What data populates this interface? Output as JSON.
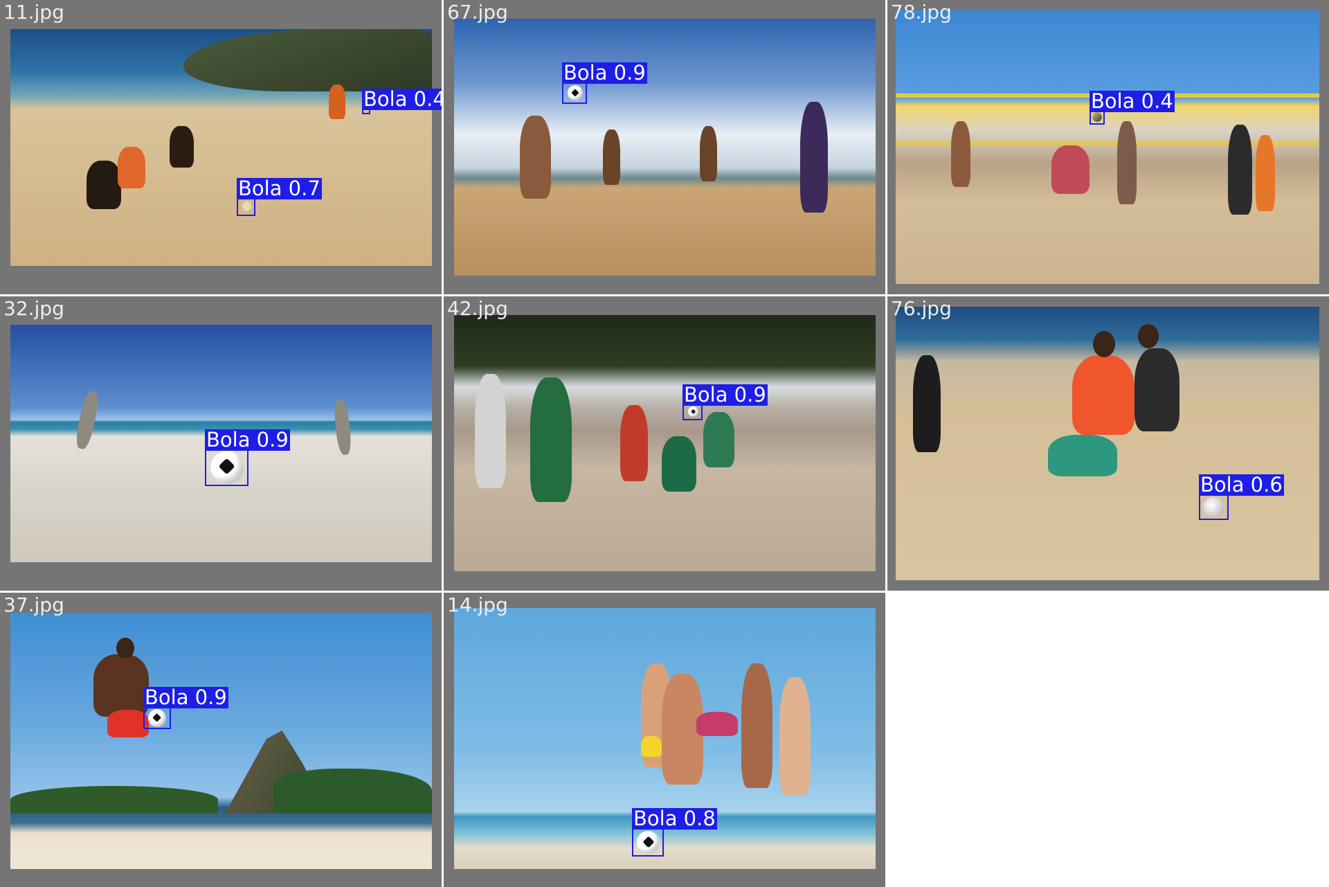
{
  "tiles": [
    {
      "filename": "11.jpg",
      "detections": [
        {
          "label": "Bola 0.4"
        },
        {
          "label": "Bola 0.7"
        }
      ]
    },
    {
      "filename": "67.jpg",
      "detections": [
        {
          "label": "Bola 0.9"
        }
      ]
    },
    {
      "filename": "78.jpg",
      "detections": [
        {
          "label": "Bola 0.4"
        }
      ]
    },
    {
      "filename": "32.jpg",
      "detections": [
        {
          "label": "Bola 0.9"
        }
      ]
    },
    {
      "filename": "42.jpg",
      "detections": [
        {
          "label": "Bola 0.9"
        }
      ]
    },
    {
      "filename": "76.jpg",
      "detections": [
        {
          "label": "Bola 0.6"
        }
      ]
    },
    {
      "filename": "37.jpg",
      "detections": [
        {
          "label": "Bola 0.9"
        }
      ]
    },
    {
      "filename": "14.jpg",
      "detections": [
        {
          "label": "Bola 0.8"
        }
      ]
    }
  ],
  "colors": {
    "tile_bg": "#757575",
    "box": "#1e1ee6",
    "label_text": "#ffffff",
    "filename_text": "#eeeeee"
  }
}
